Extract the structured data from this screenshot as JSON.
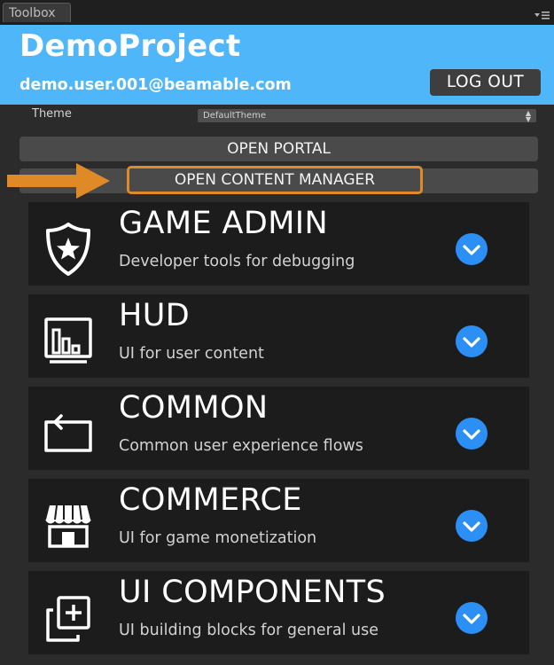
{
  "tab": {
    "label": "Toolbox"
  },
  "header": {
    "project": "DemoProject",
    "email": "demo.user.001@beamable.com",
    "logout_label": "LOG OUT"
  },
  "theme": {
    "label": "Theme",
    "value": "DefaultTheme"
  },
  "buttons": {
    "portal": "OPEN PORTAL",
    "content_manager": "OPEN CONTENT MANAGER"
  },
  "cards": [
    {
      "title": "GAME ADMIN",
      "desc": "Developer tools for debugging",
      "icon": "shield-star-icon"
    },
    {
      "title": "HUD",
      "desc": "UI for user content",
      "icon": "bar-chart-icon"
    },
    {
      "title": "COMMON",
      "desc": "Common user experience flows",
      "icon": "return-arrow-icon"
    },
    {
      "title": "COMMERCE",
      "desc": "UI for game monetization",
      "icon": "storefront-icon"
    },
    {
      "title": "UI COMPONENTS",
      "desc": "UI building blocks for general use",
      "icon": "add-layers-icon"
    }
  ],
  "colors": {
    "header_bg": "#4fb6fa",
    "highlight_orange": "#e08a27",
    "toggle_blue": "#2b8ff5",
    "card_bg": "#1c1c1c"
  }
}
